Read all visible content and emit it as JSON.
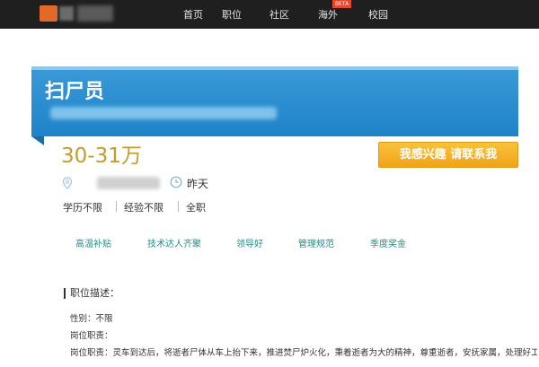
{
  "nav": {
    "items": [
      "首页",
      "职位",
      "社区",
      "海外",
      "校园"
    ],
    "badge": "BETA"
  },
  "job": {
    "title": "扫尸员",
    "salary": "30-31万",
    "posted": "昨天",
    "requirements": [
      "学历不限",
      "经验不限",
      "全职"
    ],
    "apply_button": "我感兴趣 请联系我"
  },
  "benefits": [
    "高温补贴",
    "技术达人齐聚",
    "领导好",
    "管理规范",
    "季度奖金"
  ],
  "description": {
    "title": "职位描述：",
    "gender": "性别：不限",
    "duties_label": "岗位职责：",
    "duties_text": "岗位职责：灵车到达后，将逝者尸体从车上抬下来，推进焚尸炉火化，秉着逝者为大的精神，尊重逝者，安抚家属，处理好工作时所产生的相关事务，严格遵守，保守秘密，听从安排，无怨无悔。"
  },
  "colors": {
    "topbar": "#1f1f1f",
    "banner": "#1f83c8",
    "salary": "#c79a2d",
    "cta": "#f0a318",
    "tag": "#2a8a86"
  }
}
